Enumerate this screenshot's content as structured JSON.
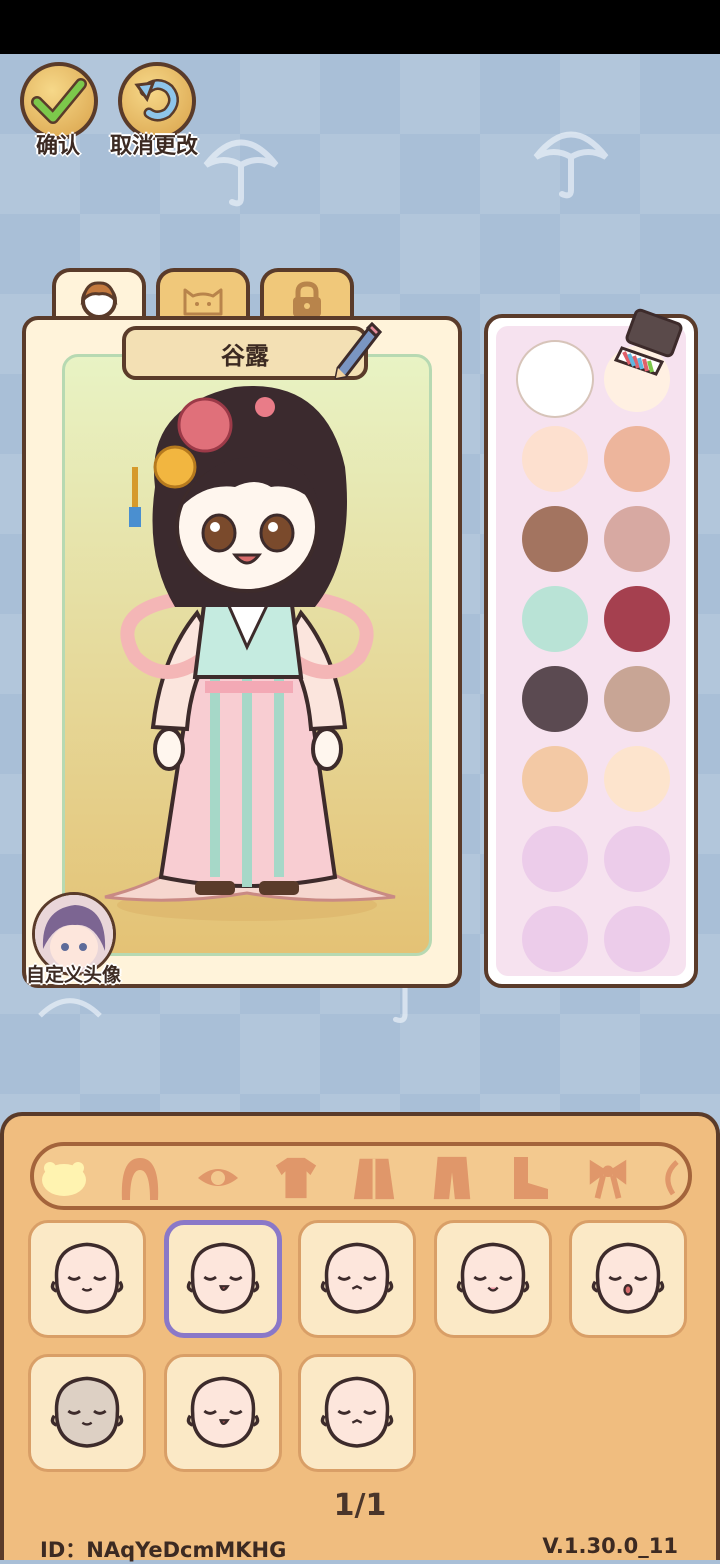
{
  "header": {
    "confirm_label": "确认",
    "cancel_label": "取消更改"
  },
  "character": {
    "name": "谷露",
    "custom_avatar_label": "自定义头像"
  },
  "tabs": [
    {
      "icon": "face-icon",
      "active": true
    },
    {
      "icon": "cat-icon",
      "active": false
    },
    {
      "icon": "lock-icon",
      "active": false
    }
  ],
  "palette": {
    "colors": [
      "#ffffff",
      "#fff0e2",
      "#fde0cf",
      "#edb59c",
      "#a37460",
      "#d7a9a2",
      "#b9e3d6",
      "#a5404f",
      "#5b4a51",
      "#c8a595",
      "#f3c9a5",
      "#fde4cd",
      "#ecccea",
      "#ecccea",
      "#ecccea",
      "#ecccea"
    ],
    "selected_index": 0
  },
  "categories": [
    "face",
    "hair",
    "eyes",
    "top",
    "coat",
    "bottom",
    "shoes",
    "accessory",
    "more"
  ],
  "faces": {
    "count": 8,
    "selected_index": 1
  },
  "pager": "1/1",
  "footer": {
    "id": "ID：NAqYeDcmMKHG",
    "version": "V.1.30.0_11"
  }
}
